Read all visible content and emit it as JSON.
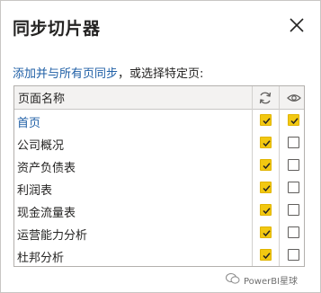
{
  "dialog": {
    "title": "同步切片器",
    "close_icon": "close-icon"
  },
  "instruction": {
    "link_text": "添加并与所有页同步",
    "rest_text": "，或选择特定页:"
  },
  "table": {
    "column_name_header": "页面名称",
    "sync_column_icon": "sync-icon",
    "visible_column_icon": "eye-icon",
    "rows": [
      {
        "name": "首页",
        "sync": true,
        "visible": true,
        "current": true
      },
      {
        "name": "公司概况",
        "sync": true,
        "visible": false,
        "current": false
      },
      {
        "name": "资产负债表",
        "sync": true,
        "visible": false,
        "current": false
      },
      {
        "name": "利润表",
        "sync": true,
        "visible": false,
        "current": false
      },
      {
        "name": "现金流量表",
        "sync": true,
        "visible": false,
        "current": false
      },
      {
        "name": "运营能力分析",
        "sync": true,
        "visible": false,
        "current": false
      },
      {
        "name": "杜邦分析",
        "sync": true,
        "visible": false,
        "current": false
      }
    ]
  },
  "watermark": {
    "text": "PowerBI星球",
    "icon": "wechat-icon"
  },
  "colors": {
    "checked_fill": "#f2c811",
    "link": "#1f5fa6",
    "header_bg": "#f3f2f1"
  }
}
